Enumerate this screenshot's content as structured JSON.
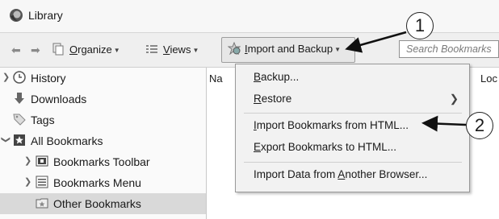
{
  "window": {
    "title": "Library"
  },
  "toolbar": {
    "organize": {
      "u": "O",
      "rest": "rganize"
    },
    "views": {
      "u": "V",
      "rest": "iews"
    },
    "import_backup": {
      "u": "I",
      "rest": "mport and Backup"
    },
    "search_placeholder": "Search Bookmarks"
  },
  "sidebar": {
    "items": [
      {
        "label": "History"
      },
      {
        "label": "Downloads"
      },
      {
        "label": "Tags"
      },
      {
        "label": "All Bookmarks"
      },
      {
        "label": "Bookmarks Toolbar"
      },
      {
        "label": "Bookmarks Menu"
      },
      {
        "label": "Other Bookmarks"
      }
    ]
  },
  "columns": {
    "name": "Na",
    "location": "Loc"
  },
  "menu": {
    "backup": {
      "u": "B",
      "rest": "ackup..."
    },
    "restore": {
      "u": "R",
      "rest": "estore"
    },
    "import_html": {
      "u": "I",
      "rest": "mport Bookmarks from HTML..."
    },
    "export_html": {
      "u": "E",
      "rest": "xport Bookmarks to HTML..."
    },
    "import_other": {
      "pre": "Import Data from ",
      "u": "A",
      "rest": "nother Browser..."
    }
  },
  "callouts": {
    "one": "1",
    "two": "2"
  }
}
